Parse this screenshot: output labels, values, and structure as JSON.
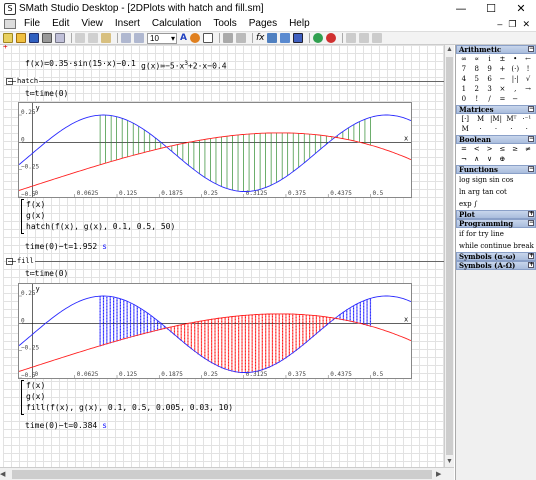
{
  "window": {
    "title": "SMath Studio Desktop - [2DPlots with hatch and fill.sm]",
    "min": "—",
    "max": "☐",
    "close": "✕"
  },
  "menu": [
    "File",
    "Edit",
    "View",
    "Insert",
    "Calculation",
    "Tools",
    "Pages",
    "Help"
  ],
  "toolbar": {
    "font_size": "10"
  },
  "worksheet": {
    "defs": {
      "f": "f(x)≔0.35·sin(15·x)−0.1",
      "g_pre": "g(x)≔−5·x",
      "g_exp": "3",
      "g_post": "+2·x−0.4"
    },
    "hatch": {
      "region_label": "hatch",
      "t_def": "t≔time(0)",
      "y_ticks": [
        "0.25",
        "0",
        "−0.25",
        "−0.5"
      ],
      "x_ticks": [
        "0",
        "0.0625",
        "0.125",
        "0.1875",
        "0.25",
        "0.3125",
        "0.375",
        "0.4375",
        "0.5"
      ],
      "axis_y": "y",
      "axis_x": "x",
      "list": [
        "f(x)",
        "g(x)",
        "hatch(f(x), g(x), 0.1, 0.5, 50)"
      ],
      "result": "time(0)−t=1.952",
      "unit": "s"
    },
    "fill": {
      "region_label": "fill",
      "t_def": "t≔time(0)",
      "y_ticks": [
        "0.25",
        "0",
        "−0.25",
        "−0.5"
      ],
      "x_ticks": [
        "0",
        "0.0625",
        "0.125",
        "0.1875",
        "0.25",
        "0.3125",
        "0.375",
        "0.4375",
        "0.5"
      ],
      "axis_y": "y",
      "axis_x": "x",
      "list": [
        "f(x)",
        "g(x)",
        "fill(f(x), g(x), 0.1, 0.5, 0.005, 0.03, 10)"
      ],
      "result": "time(0)−t=0.384",
      "unit": "s"
    }
  },
  "chart_data": [
    {
      "type": "line",
      "title": "",
      "xlabel": "x",
      "ylabel": "y",
      "xlim": [
        -0.02,
        0.56
      ],
      "ylim": [
        -0.5,
        0.36
      ],
      "x_ticks": [
        0,
        0.0625,
        0.125,
        0.1875,
        0.25,
        0.3125,
        0.375,
        0.4375,
        0.5
      ],
      "y_ticks": [
        0.25,
        0,
        -0.25,
        -0.5
      ],
      "series": [
        {
          "name": "f(x)",
          "expr": "0.35·sin(15·x)−0.1",
          "color": "#2a2aff",
          "x": [
            0,
            0.05,
            0.1,
            0.15,
            0.2,
            0.25,
            0.3,
            0.35,
            0.4,
            0.45,
            0.5,
            0.55
          ],
          "values": [
            -0.1,
            0.13,
            0.249,
            0.173,
            -0.149,
            -0.343,
            -0.445,
            -0.395,
            -0.208,
            0.1,
            0.233,
            0.205
          ]
        },
        {
          "name": "g(x)",
          "expr": "−5·x³+2·x−0.4",
          "color": "#ff2020",
          "x": [
            0,
            0.05,
            0.1,
            0.15,
            0.2,
            0.25,
            0.3,
            0.35,
            0.4,
            0.45,
            0.5,
            0.55
          ],
          "values": [
            -0.4,
            -0.301,
            -0.205,
            -0.117,
            -0.04,
            0.022,
            0.065,
            0.086,
            0.08,
            0.044,
            -0.025,
            -0.132
          ]
        },
        {
          "name": "hatch",
          "color": "#2e8b2e",
          "x_from": 0.1,
          "x_to": 0.5,
          "count": 50
        }
      ]
    },
    {
      "type": "area",
      "title": "",
      "xlabel": "x",
      "ylabel": "y",
      "xlim": [
        -0.02,
        0.56
      ],
      "ylim": [
        -0.5,
        0.36
      ],
      "x_ticks": [
        0,
        0.0625,
        0.125,
        0.1875,
        0.25,
        0.3125,
        0.375,
        0.4375,
        0.5
      ],
      "y_ticks": [
        0.25,
        0,
        -0.25,
        -0.5
      ],
      "series": [
        {
          "name": "f(x)",
          "expr": "0.35·sin(15·x)−0.1",
          "color": "#2a2aff"
        },
        {
          "name": "g(x)",
          "expr": "−5·x³+2·x−0.4",
          "color": "#ff2020"
        },
        {
          "name": "fill",
          "x_from": 0.1,
          "x_to": 0.5,
          "dx": 0.005,
          "dy": 0.03,
          "dot_size": 10,
          "color_above": "#2a2aff",
          "color_below": "#ff2020"
        }
      ]
    }
  ],
  "panel": {
    "arithmetic": {
      "title": "Arithmetic",
      "keys": [
        "∞",
        "∝",
        "i",
        "±",
        "•",
        "←",
        "7",
        "8",
        "9",
        "+",
        "(·)",
        "!",
        "4",
        "5",
        "6",
        "−",
        "|·|",
        "√",
        "1",
        "2",
        "3",
        "×",
        ",",
        "→",
        "0",
        "!",
        "/",
        "=",
        "−"
      ]
    },
    "matrices": {
      "title": "Matrices",
      "keys": [
        "[·]",
        "M",
        "|M|",
        "Mᵀ",
        "·⁻¹",
        "M",
        "·",
        "·",
        "·",
        "·"
      ]
    },
    "boolean": {
      "title": "Boolean",
      "keys": [
        "=",
        "<",
        ">",
        "≤",
        "≥",
        "≠",
        "¬",
        "∧",
        "∨",
        "⊕"
      ]
    },
    "functions": {
      "title": "Functions",
      "rows": [
        "log sign sin cos",
        "ln arg tan cot",
        "exp  ∫"
      ]
    },
    "plot": {
      "title": "Plot"
    },
    "programming": {
      "title": "Programming",
      "rows": [
        "if   for   try    line",
        "while continue break"
      ]
    },
    "sym1": {
      "title": "Symbols (α-ω)"
    },
    "sym2": {
      "title": "Symbols (Α-Ω)"
    }
  }
}
